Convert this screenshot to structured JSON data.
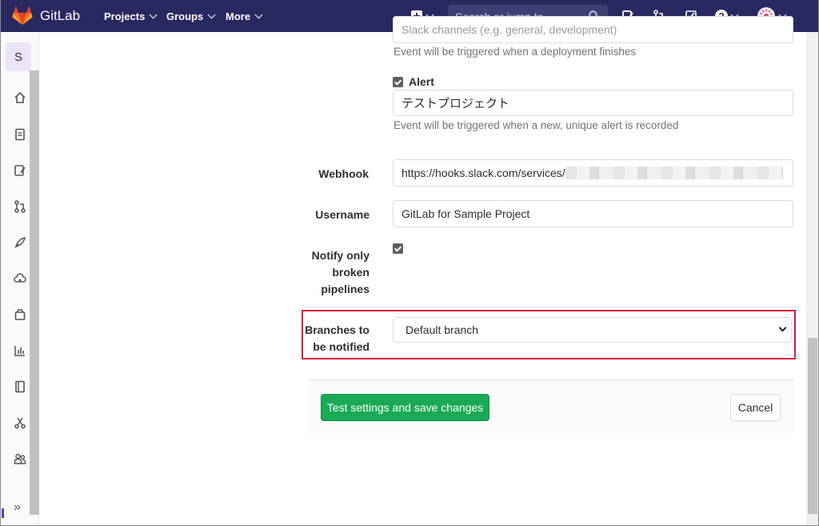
{
  "navbar": {
    "brand": "GitLab",
    "menus": [
      "Projects",
      "Groups",
      "More"
    ],
    "search_placeholder": "Search or jump to...",
    "icons": [
      "plus-square-icon",
      "issues-icon",
      "merge-request-icon",
      "todo-icon",
      "help-icon",
      "avatar-icon"
    ]
  },
  "sidebar": {
    "project_initial": "S",
    "items": [
      "home-icon",
      "repository-icon",
      "issues-icon",
      "merge-requests-icon",
      "ci-cd-icon",
      "operations-icon",
      "packages-icon",
      "analytics-icon",
      "wiki-icon",
      "snippets-icon",
      "members-icon"
    ],
    "collapse_label": "»"
  },
  "form": {
    "top_input_partial": "Slack channels (e.g. general, development)",
    "deployment_help": "Event will be triggered when a deployment finishes",
    "alert": {
      "label": "Alert",
      "checked": true,
      "value": "テストプロジェクト",
      "help": "Event will be triggered when a new, unique alert is recorded"
    },
    "webhook": {
      "label": "Webhook",
      "value": "https://hooks.slack.com/services/"
    },
    "username": {
      "label": "Username",
      "value": "GitLab for Sample Project"
    },
    "notify_broken": {
      "label_line1": "Notify only",
      "label_line2": "broken",
      "label_line3": "pipelines",
      "checked": true
    },
    "branches": {
      "label_line1": "Branches to",
      "label_line2": "be notified",
      "selected": "Default branch"
    }
  },
  "actions": {
    "save_label": "Test settings and save changes",
    "cancel_label": "Cancel"
  },
  "colors": {
    "navbar": "#292961",
    "save_button": "#1aaa55",
    "highlight_border": "#d0223f"
  }
}
